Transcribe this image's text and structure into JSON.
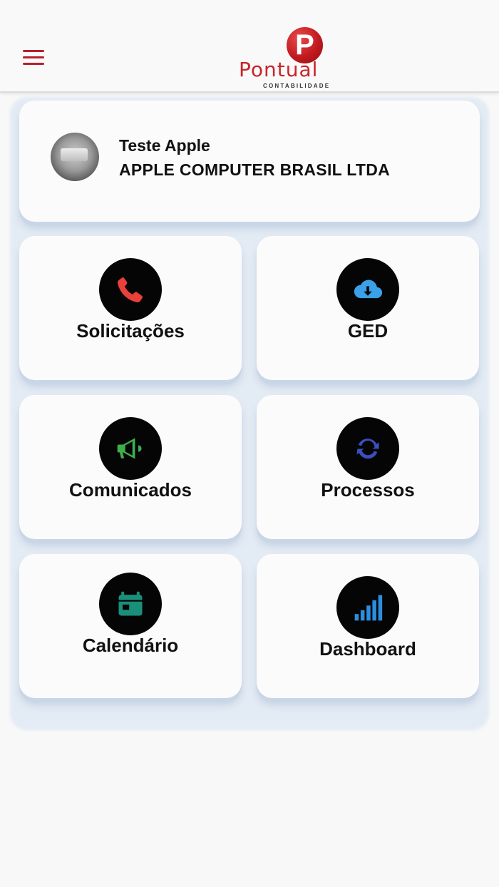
{
  "header": {
    "menu_icon": "hamburger-menu-icon",
    "logo": {
      "letter": "P",
      "name": "Pontual",
      "subtitle": "CONTABILIDADE",
      "color": "#c9242a"
    }
  },
  "profile": {
    "name": "Teste Apple",
    "company": "APPLE COMPUTER BRASIL LTDA"
  },
  "tiles": [
    {
      "label": "Solicitações",
      "icon": "phone-icon",
      "icon_color": "#e8403a"
    },
    {
      "label": "GED",
      "icon": "cloud-download-icon",
      "icon_color": "#3aa0e8"
    },
    {
      "label": "Comunicados",
      "icon": "megaphone-icon",
      "icon_color": "#3fae4a"
    },
    {
      "label": "Processos",
      "icon": "sync-icon",
      "icon_color": "#3a4fc0"
    },
    {
      "label": "Calendário",
      "icon": "calendar-icon",
      "icon_color": "#1a8f7a"
    },
    {
      "label": "Dashboard",
      "icon": "signal-bars-icon",
      "icon_color": "#2a8fe0"
    }
  ]
}
